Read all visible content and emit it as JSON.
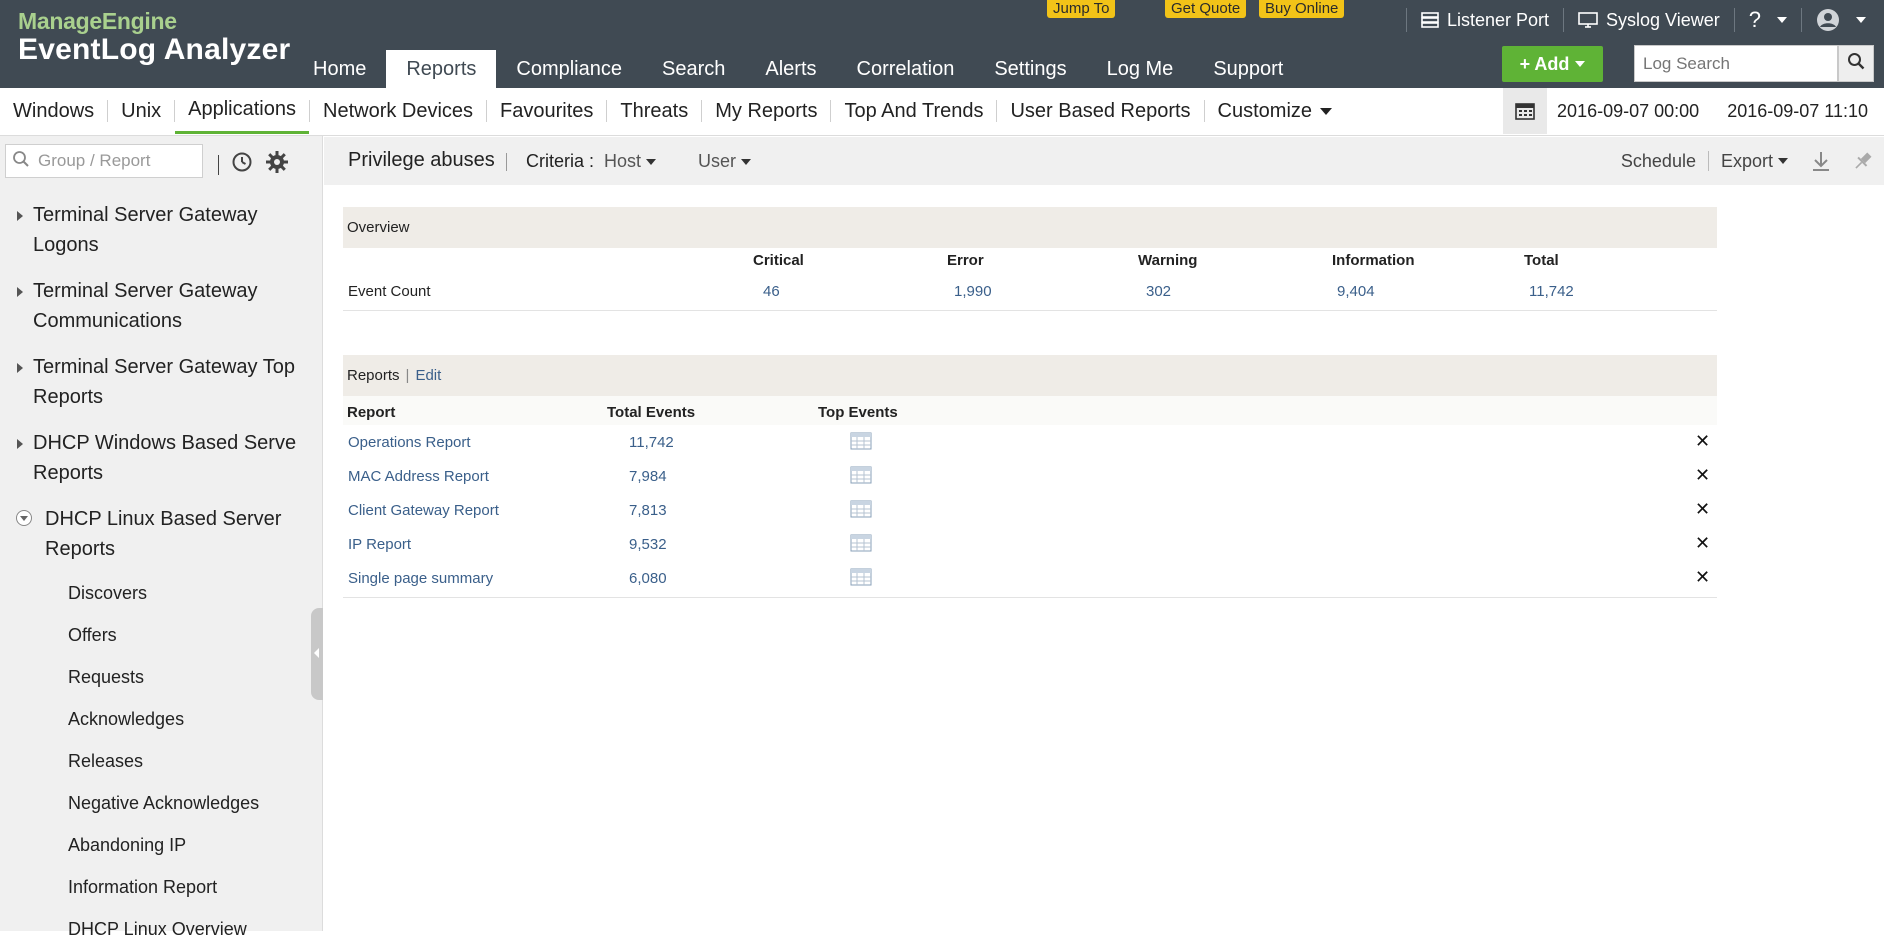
{
  "header": {
    "brand": "ManageEngine",
    "product": "EventLog Analyzer",
    "promos": {
      "jump_to": "Jump To",
      "get_quote": "Get Quote",
      "buy_online": "Buy Online"
    },
    "utils": {
      "listener_port": "Listener Port",
      "syslog_viewer": "Syslog Viewer",
      "help": "?"
    },
    "main_tabs": [
      "Home",
      "Reports",
      "Compliance",
      "Search",
      "Alerts",
      "Correlation",
      "Settings",
      "Log Me",
      "Support"
    ],
    "active_tab": "Reports",
    "add_label": "+ Add",
    "log_search_placeholder": "Log Search"
  },
  "subnav": {
    "items": [
      "Windows",
      "Unix",
      "Applications",
      "Network Devices",
      "Favourites",
      "Threats",
      "My Reports",
      "Top And Trends",
      "User Based Reports",
      "Customize"
    ],
    "active": "Applications",
    "date_from": "2016-09-07 00:00",
    "date_to": "2016-09-07 11:10"
  },
  "sidebar": {
    "search_placeholder": "Group / Report",
    "groups": [
      "Terminal Server Gateway Logons",
      "Terminal Server Gateway Communications",
      "Terminal Server Gateway Top Reports",
      "DHCP Windows Based Serve Reports"
    ],
    "open_group": "DHCP Linux Based Server Reports",
    "sub_items": [
      "Discovers",
      "Offers",
      "Requests",
      "Acknowledges",
      "Releases",
      "Negative Acknowledges",
      "Abandoning IP",
      "Information Report",
      "DHCP Linux Overview"
    ]
  },
  "content": {
    "title": "Privilege abuses",
    "criteria_label": "Criteria :",
    "criteria_host": "Host",
    "criteria_user": "User",
    "schedule": "Schedule",
    "export": "Export"
  },
  "overview": {
    "title": "Overview",
    "columns": [
      "Critical",
      "Error",
      "Warning",
      "Information",
      "Total"
    ],
    "row_label": "Event Count",
    "values": [
      "46",
      "1,990",
      "302",
      "9,404",
      "11,742"
    ]
  },
  "reports": {
    "title": "Reports",
    "edit": "Edit",
    "columns": [
      "Report",
      "Total Events",
      "Top Events"
    ],
    "rows": [
      {
        "name": "Operations Report",
        "total": "11,742"
      },
      {
        "name": "MAC Address Report",
        "total": "7,984"
      },
      {
        "name": "Client Gateway Report",
        "total": "7,813"
      },
      {
        "name": "IP Report",
        "total": "9,532"
      },
      {
        "name": "Single page summary",
        "total": "6,080"
      }
    ],
    "delete_glyph": "✕"
  },
  "colors": {
    "header_bg": "#404a53",
    "accent_green": "#5fb336",
    "promo_yellow": "#f2c318",
    "link_blue": "#3a5f8a"
  }
}
